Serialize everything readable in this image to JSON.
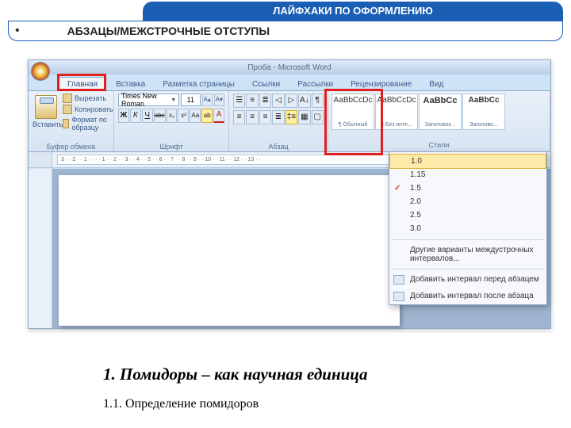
{
  "slide": {
    "banner": "ЛАЙФХАКИ ПО ОФОРМЛЕНИЮ",
    "bullet": "•",
    "subheading": "АБЗАЦЫ/МЕЖСТРОЧНЫЕ ОТСТУПЫ"
  },
  "window": {
    "title": "Проба - Microsoft Word"
  },
  "tabs": {
    "home": "Главная",
    "insert": "Вставка",
    "layout": "Разметка страницы",
    "refs": "Ссылки",
    "mail": "Рассылки",
    "review": "Рецензирование",
    "view": "Вид"
  },
  "clipboard": {
    "paste": "Вставить",
    "cut": "Вырезать",
    "copy": "Копировать",
    "fmt": "Формат по образцу",
    "group": "Буфер обмена"
  },
  "font": {
    "name": "Times New Roman",
    "size": "11",
    "grow": "A▴",
    "shrink": "A▾",
    "bold": "Ж",
    "italic": "К",
    "under": "Ч",
    "strike": "abc",
    "sub": "x₂",
    "sup": "x²",
    "case": "Aa",
    "hl": "ab",
    "color": "A",
    "group": "Шрифт"
  },
  "para": {
    "group": "Абзац"
  },
  "styles": {
    "preview": "АаBbCcDc",
    "preview_bold": "АаBbCс",
    "s1": "¶ Обычный",
    "s2": "¶ Без инте...",
    "s3": "Заголовок...",
    "s4": "Заголово...",
    "group": "Стили"
  },
  "ruler": {
    "marks": "3 · · 2 · · 1 · · · · 1 · · 2 · · 3 · · 4 · · 5 · · 6 · · 7 · · 8 · · 9 · · 10 · · 11 · · 12 · · 13 · ·"
  },
  "spacing": {
    "v10": "1.0",
    "v115": "1.15",
    "v15": "1.5",
    "v20": "2.0",
    "v25": "2.5",
    "v30": "3.0",
    "other": "Другие варианты междустрочных интервалов...",
    "before": "Добавить интервал перед абзацем",
    "after": "Добавить интервал после абзаца",
    "check": "✓"
  },
  "doc": {
    "h1": "1. Помидоры – как научная единица",
    "h2": "1.1. Определение помидоров"
  }
}
